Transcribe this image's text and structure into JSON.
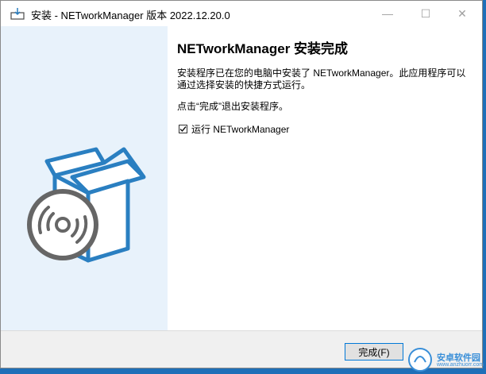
{
  "window": {
    "title": "安装 - NETworkManager 版本 2022.12.20.0",
    "minimize_glyph": "—",
    "maximize_glyph": "☐",
    "close_glyph": "✕"
  },
  "content": {
    "heading": "NETworkManager 安装完成",
    "description": "安装程序已在您的电脑中安装了 NETworkManager。此应用程序可以通过选择安装的快捷方式运行。",
    "note": "点击“完成”退出安装程序。",
    "run_checkbox": {
      "label": "运行 NETworkManager",
      "checked": true
    }
  },
  "footer": {
    "finish_label": "完成(F)"
  },
  "watermark": {
    "text": "安卓软件园",
    "url": "www.anzhuorr.com"
  },
  "colors": {
    "accent": "#0078d7",
    "sidebar": "#e8f2fb",
    "box_blue": "#2a7fc1",
    "disc_gray": "#666666"
  },
  "icons": [
    "installer-icon",
    "minimize-icon",
    "maximize-icon",
    "close-icon",
    "box-disc-illustration",
    "check-icon"
  ]
}
